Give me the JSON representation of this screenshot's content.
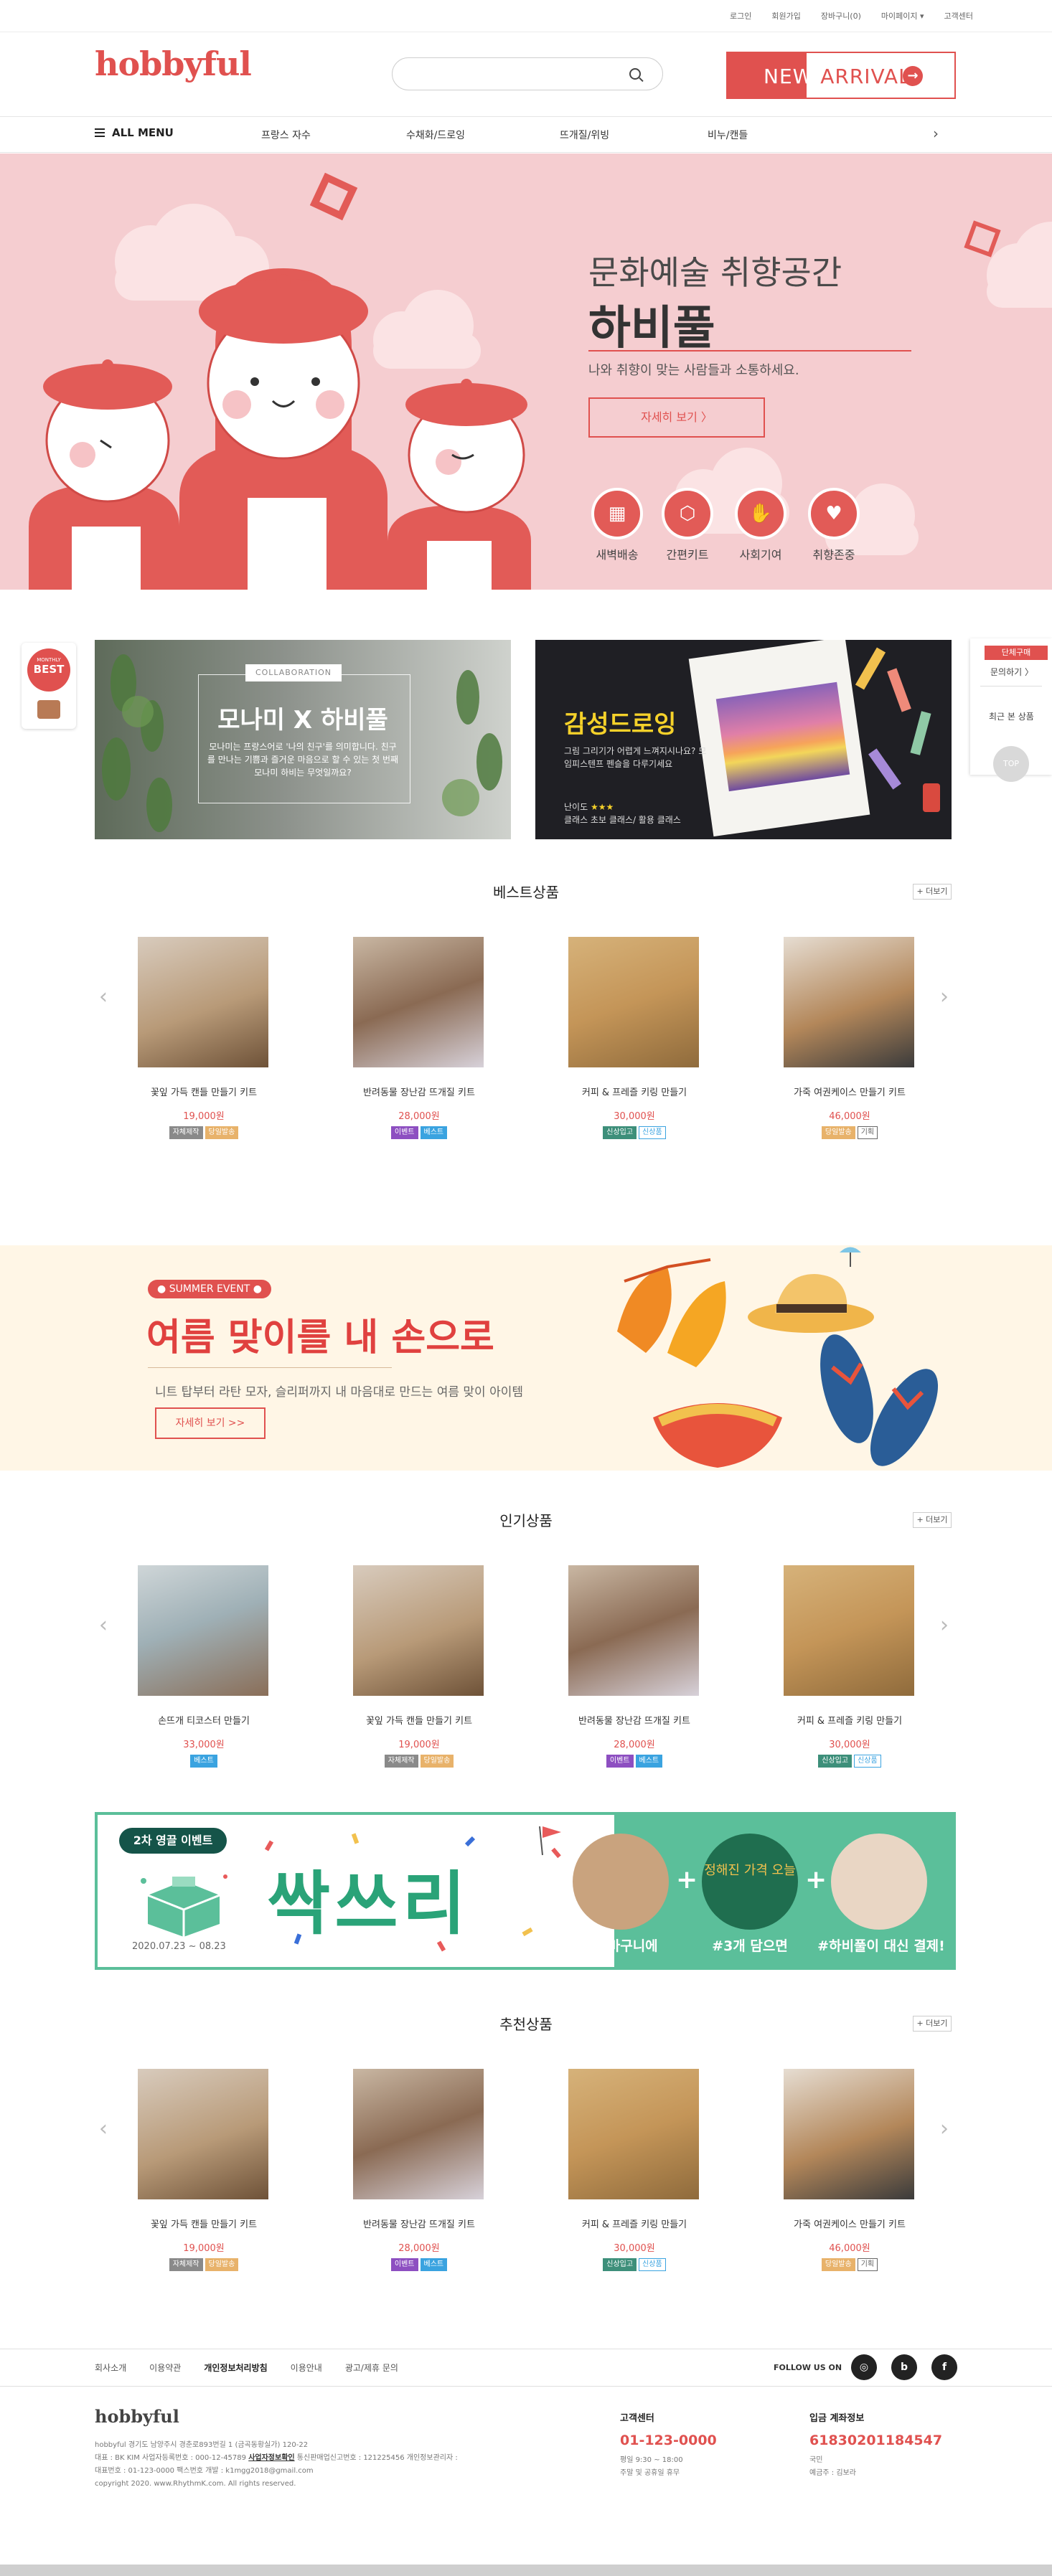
{
  "util_menu": [
    "로그인",
    "회원가입",
    "장바구니(0)",
    "마이페이지 ▾",
    "고객센터"
  ],
  "header": {
    "logo": "hobbyful",
    "search_placeholder": "",
    "new_label": "NEW",
    "arrival_label": "ARRIVAL"
  },
  "nav": {
    "all_menu": "ALL MENU",
    "items": [
      "프랑스 자수",
      "수채화/드로잉",
      "뜨개질/위빙",
      "비누/캔들"
    ]
  },
  "hero": {
    "title1": "문화예술 취향공간",
    "title2": "하비풀",
    "subtitle": "나와 취향이 맞는 사람들과 소통하세요.",
    "button": "자세히 보기  〉",
    "icons": [
      {
        "label": "새벽배송",
        "icon": "delivery-icon"
      },
      {
        "label": "간편키트",
        "icon": "kit-icon"
      },
      {
        "label": "사회기여",
        "icon": "contribution-icon"
      },
      {
        "label": "취향존중",
        "icon": "heart-icon"
      }
    ]
  },
  "side": {
    "badge_small": "MONTHLY",
    "badge_big": "BEST",
    "inquiry_badge": "단체구매",
    "inquiry_text": "문의하기 〉",
    "recent": "최근 본 상품",
    "top": "TOP"
  },
  "banners": {
    "collab_tag": "COLLABORATION",
    "collab_title": "모나미 X 하비풀",
    "collab_desc": "모나미는 프랑스어로 '나의 친구'를 의미합니다. 친구를 만나는 기쁨과 즐거운 마음으로 할 수 있는 첫 번째 모나미 하비는 무엇일까요?",
    "drawing_title": "감성드로잉",
    "drawing_desc": "그림 그리기가 어렵게 느껴지시나요? 모임피스텐프 펜슬을 다루기세요",
    "drawing_level_label": "난이도",
    "drawing_stars": "★★★",
    "drawing_class": "클래스 초보 클래스/ 활용 클래스"
  },
  "sections": {
    "best": "베스트상품",
    "popular": "인기상품",
    "recommend": "추천상품",
    "more": "+ 더보기"
  },
  "products_best": [
    {
      "name": "꽃잎 가득 캔들 만들기 키트",
      "price": "19,000원",
      "tags": [
        {
          "t": "자체제작",
          "c": "#8a8a8a"
        },
        {
          "t": "당일발송",
          "c": "#e8b26a"
        }
      ]
    },
    {
      "name": "반려동물 장난감 뜨개질 키트",
      "price": "28,000원",
      "tags": [
        {
          "t": "이벤트",
          "c": "#8d4fc1"
        },
        {
          "t": "베스트",
          "c": "#3aa3e0"
        }
      ]
    },
    {
      "name": "커피 & 프레즐 키링 만들기",
      "price": "30,000원",
      "tags": [
        {
          "t": "신상입고",
          "c": "#3d8f7a"
        },
        {
          "t": "신상품",
          "c": "#3aa3e0",
          "outline": true
        }
      ]
    },
    {
      "name": "가죽 여권케이스 만들기 키트",
      "price": "46,000원",
      "tags": [
        {
          "t": "당일발송",
          "c": "#e8b26a"
        },
        {
          "t": "기획",
          "c": "#666",
          "outline": true
        }
      ]
    }
  ],
  "summer": {
    "badge": "SUMMER EVENT",
    "title": "여름 맞이를 내 손으로",
    "desc": "니트 탑부터 라탄 모자, 슬리퍼까지 내 마음대로 만드는 여름 맞이 아이템",
    "button": "자세히 보기 >>"
  },
  "products_popular": [
    {
      "name": "손뜨개 티코스터 만들기",
      "price": "33,000원",
      "tags": [
        {
          "t": "베스트",
          "c": "#3aa3e0"
        }
      ]
    },
    {
      "name": "꽃잎 가득 캔들 만들기 키트",
      "price": "19,000원",
      "tags": [
        {
          "t": "자체제작",
          "c": "#8a8a8a"
        },
        {
          "t": "당일발송",
          "c": "#e8b26a"
        }
      ]
    },
    {
      "name": "반려동물 장난감 뜨개질 키트",
      "price": "28,000원",
      "tags": [
        {
          "t": "이벤트",
          "c": "#8d4fc1"
        },
        {
          "t": "베스트",
          "c": "#3aa3e0"
        }
      ]
    },
    {
      "name": "커피 & 프레즐 키링 만들기",
      "price": "30,000원",
      "tags": [
        {
          "t": "신상입고",
          "c": "#3d8f7a"
        },
        {
          "t": "신상품",
          "c": "#3aa3e0",
          "outline": true
        }
      ]
    }
  ],
  "event2": {
    "badge": "2차 영끌 이벤트",
    "big": "싹쓰리",
    "date": "2020.07.23 ~ 08.23",
    "circle2_text": "정해진 가격 오늘",
    "captions": [
      "#장바구니에",
      "#3개 담으면",
      "#하비풀이 대신 결제!"
    ]
  },
  "products_recommend": [
    {
      "name": "꽃잎 가득 캔들 만들기 키트",
      "price": "19,000원",
      "tags": [
        {
          "t": "자체제작",
          "c": "#8a8a8a"
        },
        {
          "t": "당일발송",
          "c": "#e8b26a"
        }
      ]
    },
    {
      "name": "반려동물 장난감 뜨개질 키트",
      "price": "28,000원",
      "tags": [
        {
          "t": "이벤트",
          "c": "#8d4fc1"
        },
        {
          "t": "베스트",
          "c": "#3aa3e0"
        }
      ]
    },
    {
      "name": "커피 & 프레즐 키링 만들기",
      "price": "30,000원",
      "tags": [
        {
          "t": "신상입고",
          "c": "#3d8f7a"
        },
        {
          "t": "신상품",
          "c": "#3aa3e0",
          "outline": true
        }
      ]
    },
    {
      "name": "가죽 여권케이스 만들기 키트",
      "price": "46,000원",
      "tags": [
        {
          "t": "당일발송",
          "c": "#e8b26a"
        },
        {
          "t": "기획",
          "c": "#666",
          "outline": true
        }
      ]
    }
  ],
  "footer": {
    "links": [
      "회사소개",
      "이용약관",
      "개인정보처리방침",
      "이용안내",
      "광고/제휴 문의"
    ],
    "follow": "FOLLOW US ON",
    "sns": [
      "instagram-icon",
      "blog-icon",
      "facebook-icon"
    ],
    "logo": "hobbyful",
    "info_lines": [
      "hobbyful  경기도 남양주시 경춘로893번길 1 (금곡동황실가) 120-22",
      "대표 : BK KIM    사업자등록번호 : 000-12-45789",
      "대표번호 : 01-123-0000    팩스번호    개발 : k1mgg2018@gmail.com",
      "copyright 2020. www.RhythmK.com. All rights reserved."
    ],
    "info_link": "사업자정보확인",
    "info_extra": "통신판매업신고번호 : 121225456    개인정보관리자 :",
    "cs_title": "고객센터",
    "cs_number": "01-123-0000",
    "cs_hours": [
      "평일 9:30 ~ 18:00",
      "주말 및 공휴일 휴무"
    ],
    "bank_title": "입금 계좌정보",
    "bank_number": "61830201184547",
    "bank_lines": [
      "국민",
      "예금주 : 김보라"
    ]
  }
}
